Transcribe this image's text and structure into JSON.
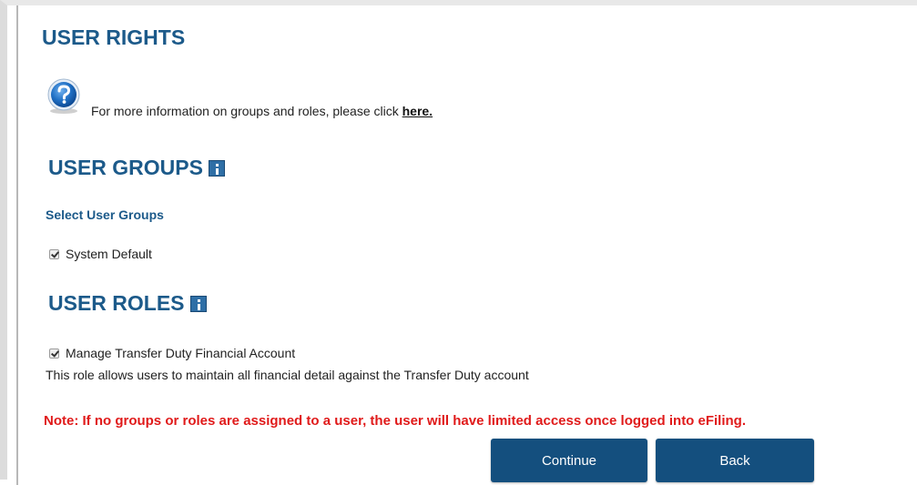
{
  "page_title": "USER RIGHTS",
  "info": {
    "text": "For more information on groups and roles, please click ",
    "link_label": "here."
  },
  "groups": {
    "heading": "USER GROUPS",
    "subheading": "Select User Groups",
    "items": [
      {
        "label": "System Default",
        "checked": true
      }
    ]
  },
  "roles": {
    "heading": "USER ROLES",
    "items": [
      {
        "label": "Manage Transfer Duty Financial Account",
        "checked": true,
        "description": "This role allows users to maintain all financial detail against the Transfer Duty account"
      }
    ]
  },
  "note": "Note: If no groups or roles are assigned to a user, the user will have limited access once logged into eFiling.",
  "buttons": {
    "continue_label": "Continue",
    "back_label": "Back"
  },
  "colors": {
    "heading": "#1c5a8a",
    "note": "#e01a1a",
    "button": "#144f7e"
  },
  "icons": {
    "help": "question-circle-icon",
    "info": "info-square-icon"
  }
}
